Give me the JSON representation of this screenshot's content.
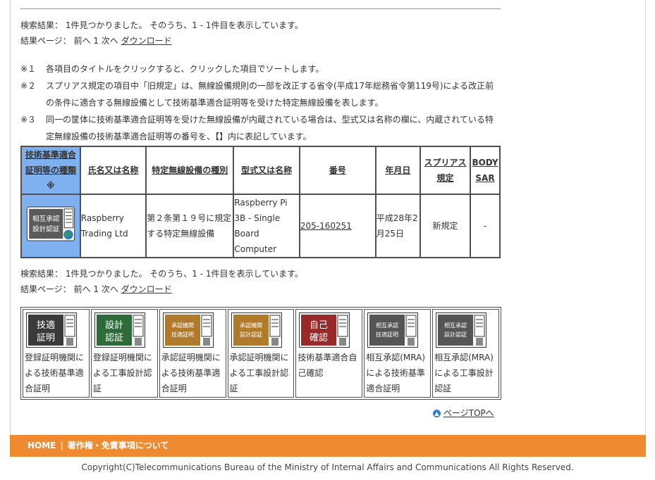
{
  "summary_top": {
    "text": "検索結果： 1件見つかりました。 そのうち、1 - 1件目を表示しています。",
    "page_prefix": "結果ページ： 前へ 1 次へ",
    "download": "ダウンロード"
  },
  "notes": [
    {
      "mark": "※１",
      "text": "各項目のタイトルをクリックすると、クリックした項目でソートします。"
    },
    {
      "mark": "※２",
      "text": "スプリアス規定の項目中「旧規定」は、無線設備規則の一部を改正する省令(平成17年総務省令第119号)による改正前の条件に適合する無線設備として技術基準適合証明等を受けた特定無線設備を表します。"
    },
    {
      "mark": "※３",
      "text": "同一の筐体に技術基準適合証明等を受けた無線設備が内蔵されている場合は、型式又は名称の欄に、内蔵されている特定無線設備の技術基準適合証明等の番号を、【】内に表記しています。"
    }
  ],
  "table": {
    "headers": [
      {
        "line1": "技術基準適合",
        "line2": "証明等の種類",
        "line3": "※"
      },
      {
        "line1": "氏名又は名称"
      },
      {
        "line1": "特定無線設備の種別"
      },
      {
        "line1": "型式又は名称"
      },
      {
        "line1": "番号"
      },
      {
        "line1": "年月日"
      },
      {
        "line1": "スプリアス",
        "line2": "規定"
      },
      {
        "line1": "BODY",
        "line2": "SAR"
      }
    ],
    "row": {
      "icon_line1": "相互承認",
      "icon_line2": "設計認証",
      "name": "Raspberry Trading Ltd",
      "type": "第２条第１９号に規定する特定無線設備",
      "model": "Raspberry Pi 3B - Single Board Computer",
      "number": "205-160251",
      "date": "平成28年2月25日",
      "spurious": "新規定",
      "body_sar": "-"
    }
  },
  "summary_bottom": {
    "text": "検索結果： 1件見つかりました。 そのうち、1 - 1件目を表示しています。",
    "page_prefix": "結果ページ： 前へ 1 次へ",
    "download": "ダウンロード"
  },
  "legend": [
    {
      "icon": "技適\n証明",
      "label": "登録証明機関による技術基準適合証明",
      "color": "#3a3a3a"
    },
    {
      "icon": "設計\n認証",
      "label": "登録証明機関による工事設計認証",
      "color": "#2f6a3a"
    },
    {
      "icon": "承認機関\n技適証明",
      "label": "承認証明機関による技術基準適合証明",
      "color": "#b07a2a"
    },
    {
      "icon": "承認機関\n設計認証",
      "label": "承認証明機関による工事設計認証",
      "color": "#b07a2a"
    },
    {
      "icon": "自己\n確認",
      "label": "技術基準適合自己確認",
      "color": "#9a2a2a"
    },
    {
      "icon": "相互承認\n技適証明",
      "label": "相互承認(MRA)による技術基準適合証明",
      "color": "#555555"
    },
    {
      "icon": "相互承認\n設計認証",
      "label": "相互承認(MRA)による工事設計認証",
      "color": "#555555"
    }
  ],
  "page_top": "ページTOPへ",
  "footer": {
    "home": "HOME",
    "separator": "|",
    "copyright_link": "著作権・免責事項について",
    "color": "#ef8a30"
  },
  "copyright": "Copyright(C)Telecommunications Bureau of the Ministry of Internal Affairs and Communications All Rights Reserved."
}
